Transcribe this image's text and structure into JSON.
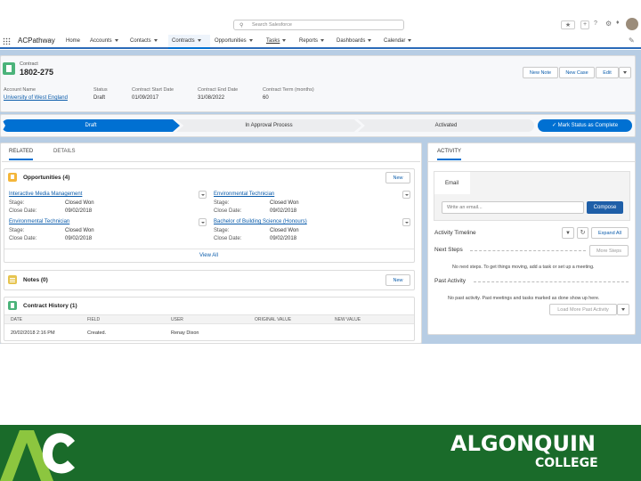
{
  "search": {
    "placeholder": "Search Salesforce"
  },
  "app": {
    "name": "ACPathway"
  },
  "nav": {
    "items": [
      "Home",
      "Accounts",
      "Contacts",
      "Contracts",
      "Opportunities",
      "Tasks",
      "Reports",
      "Dashboards",
      "Calendar"
    ],
    "active": "Contracts"
  },
  "record": {
    "type_label": "Contract",
    "number": "1802-275",
    "buttons": {
      "new_note": "New Note",
      "new_case": "New Case",
      "edit": "Edit"
    },
    "fields": [
      {
        "label": "Account Name",
        "value": "University of West England"
      },
      {
        "label": "Status",
        "value": "Draft"
      },
      {
        "label": "Contract Start Date",
        "value": "01/09/2017"
      },
      {
        "label": "Contract End Date",
        "value": "31/08/2022"
      },
      {
        "label": "Contract Term (months)",
        "value": "60"
      }
    ]
  },
  "path": {
    "steps": [
      "Draft",
      "In Approval Process",
      "Activated"
    ],
    "complete_button": "Mark Status as Complete"
  },
  "tabs": {
    "related": "RELATED",
    "details": "DETAILS",
    "activity": "ACTIVITY"
  },
  "opportunities": {
    "title": "Opportunities (4)",
    "new": "New",
    "view_all": "View All",
    "items": [
      {
        "name": "Interactive Media Management",
        "stage_label": "Stage:",
        "stage": "Closed Won",
        "date_label": "Close Date:",
        "date": "09/02/2018"
      },
      {
        "name": "Environmental Technician",
        "stage_label": "Stage:",
        "stage": "Closed Won",
        "date_label": "Close Date:",
        "date": "09/02/2018"
      },
      {
        "name": "Environmental Technician",
        "stage_label": "Stage:",
        "stage": "Closed Won",
        "date_label": "Close Date:",
        "date": "09/02/2018"
      },
      {
        "name": "Bachelor of Building Science (Honours)",
        "stage_label": "Stage:",
        "stage": "Closed Won",
        "date_label": "Close Date:",
        "date": "09/02/2018"
      }
    ]
  },
  "notes": {
    "title": "Notes (0)",
    "new": "New"
  },
  "history": {
    "title": "Contract History (1)",
    "columns": [
      "DATE",
      "FIELD",
      "USER",
      "ORIGINAL VALUE",
      "NEW VALUE"
    ],
    "rows": [
      [
        "20/02/2018 2:16 PM",
        "Created.",
        "Renay Dixon",
        "",
        ""
      ]
    ]
  },
  "activity": {
    "email_tab": "Email",
    "email_placeholder": "Write an email...",
    "compose": "Compose",
    "timeline": "Activity Timeline",
    "expand_all": "Expand All",
    "next_steps": "Next Steps",
    "more_steps": "More Steps",
    "next_steps_empty": "No next steps. To get things moving, add a task or set up a meeting.",
    "past_activity": "Past Activity",
    "past_empty": "No past activity. Past meetings and tasks marked as done show up here.",
    "load_more": "Load More Past Activity"
  },
  "footer": {
    "brand_line1": "ALGONQUIN",
    "brand_line2": "COLLEGE"
  },
  "colors": {
    "accent": "#0070d2",
    "footer_green": "#1a6b2a",
    "path_done": "#0070d2"
  }
}
